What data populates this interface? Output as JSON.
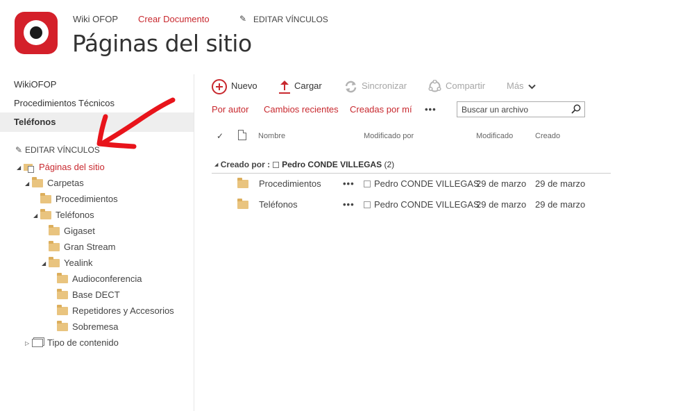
{
  "header": {
    "wiki_link": "Wiki OFOP",
    "create_link": "Crear Documento",
    "edit_links": "EDITAR VÍNCULOS",
    "page_title": "Páginas del sitio"
  },
  "quicklaunch": {
    "items": [
      {
        "label": "WikiOFOP",
        "selected": false
      },
      {
        "label": "Procedimientos Técnicos",
        "selected": false
      },
      {
        "label": "Teléfonos",
        "selected": true
      }
    ],
    "edit_links": "EDITAR VÍNCULOS"
  },
  "tree": {
    "root": "Páginas del sitio",
    "carpetas": "Carpetas",
    "procedimientos": "Procedimientos",
    "telefonos": "Teléfonos",
    "gigaset": "Gigaset",
    "granstream": "Gran Stream",
    "yealink": "Yealink",
    "audioconferencia": "Audioconferencia",
    "basedect": "Base DECT",
    "repetidores": "Repetidores y Accesorios",
    "sobremesa": "Sobremesa",
    "tipo_contenido": "Tipo de contenido"
  },
  "commands": {
    "nuevo": "Nuevo",
    "cargar": "Cargar",
    "sincronizar": "Sincronizar",
    "compartir": "Compartir",
    "mas": "Más"
  },
  "views": {
    "por_autor": "Por autor",
    "cambios_recientes": "Cambios recientes",
    "creadas_por_mi": "Creadas por mí",
    "more": "•••"
  },
  "search": {
    "placeholder": "Buscar un archivo"
  },
  "columns": {
    "check": "✓",
    "nombre": "Nombre",
    "modificado_por": "Modificado por",
    "modificado": "Modificado",
    "creado": "Creado"
  },
  "group": {
    "label": "Creado por :",
    "name": "Pedro CONDE VILLEGAS",
    "count": "(2)"
  },
  "rows": [
    {
      "name": "Procedimientos",
      "dots": "•••",
      "modified_by": "Pedro CONDE VILLEGAS",
      "modified": "29 de marzo",
      "created": "29 de marzo"
    },
    {
      "name": "Teléfonos",
      "dots": "•••",
      "modified_by": "Pedro CONDE VILLEGAS",
      "modified": "29 de marzo",
      "created": "29 de marzo"
    }
  ],
  "colors": {
    "accent": "#c8282e",
    "disabled": "#a6a6a6",
    "folder": "#e9c47f",
    "annotation_arrow": "#e8141b"
  }
}
